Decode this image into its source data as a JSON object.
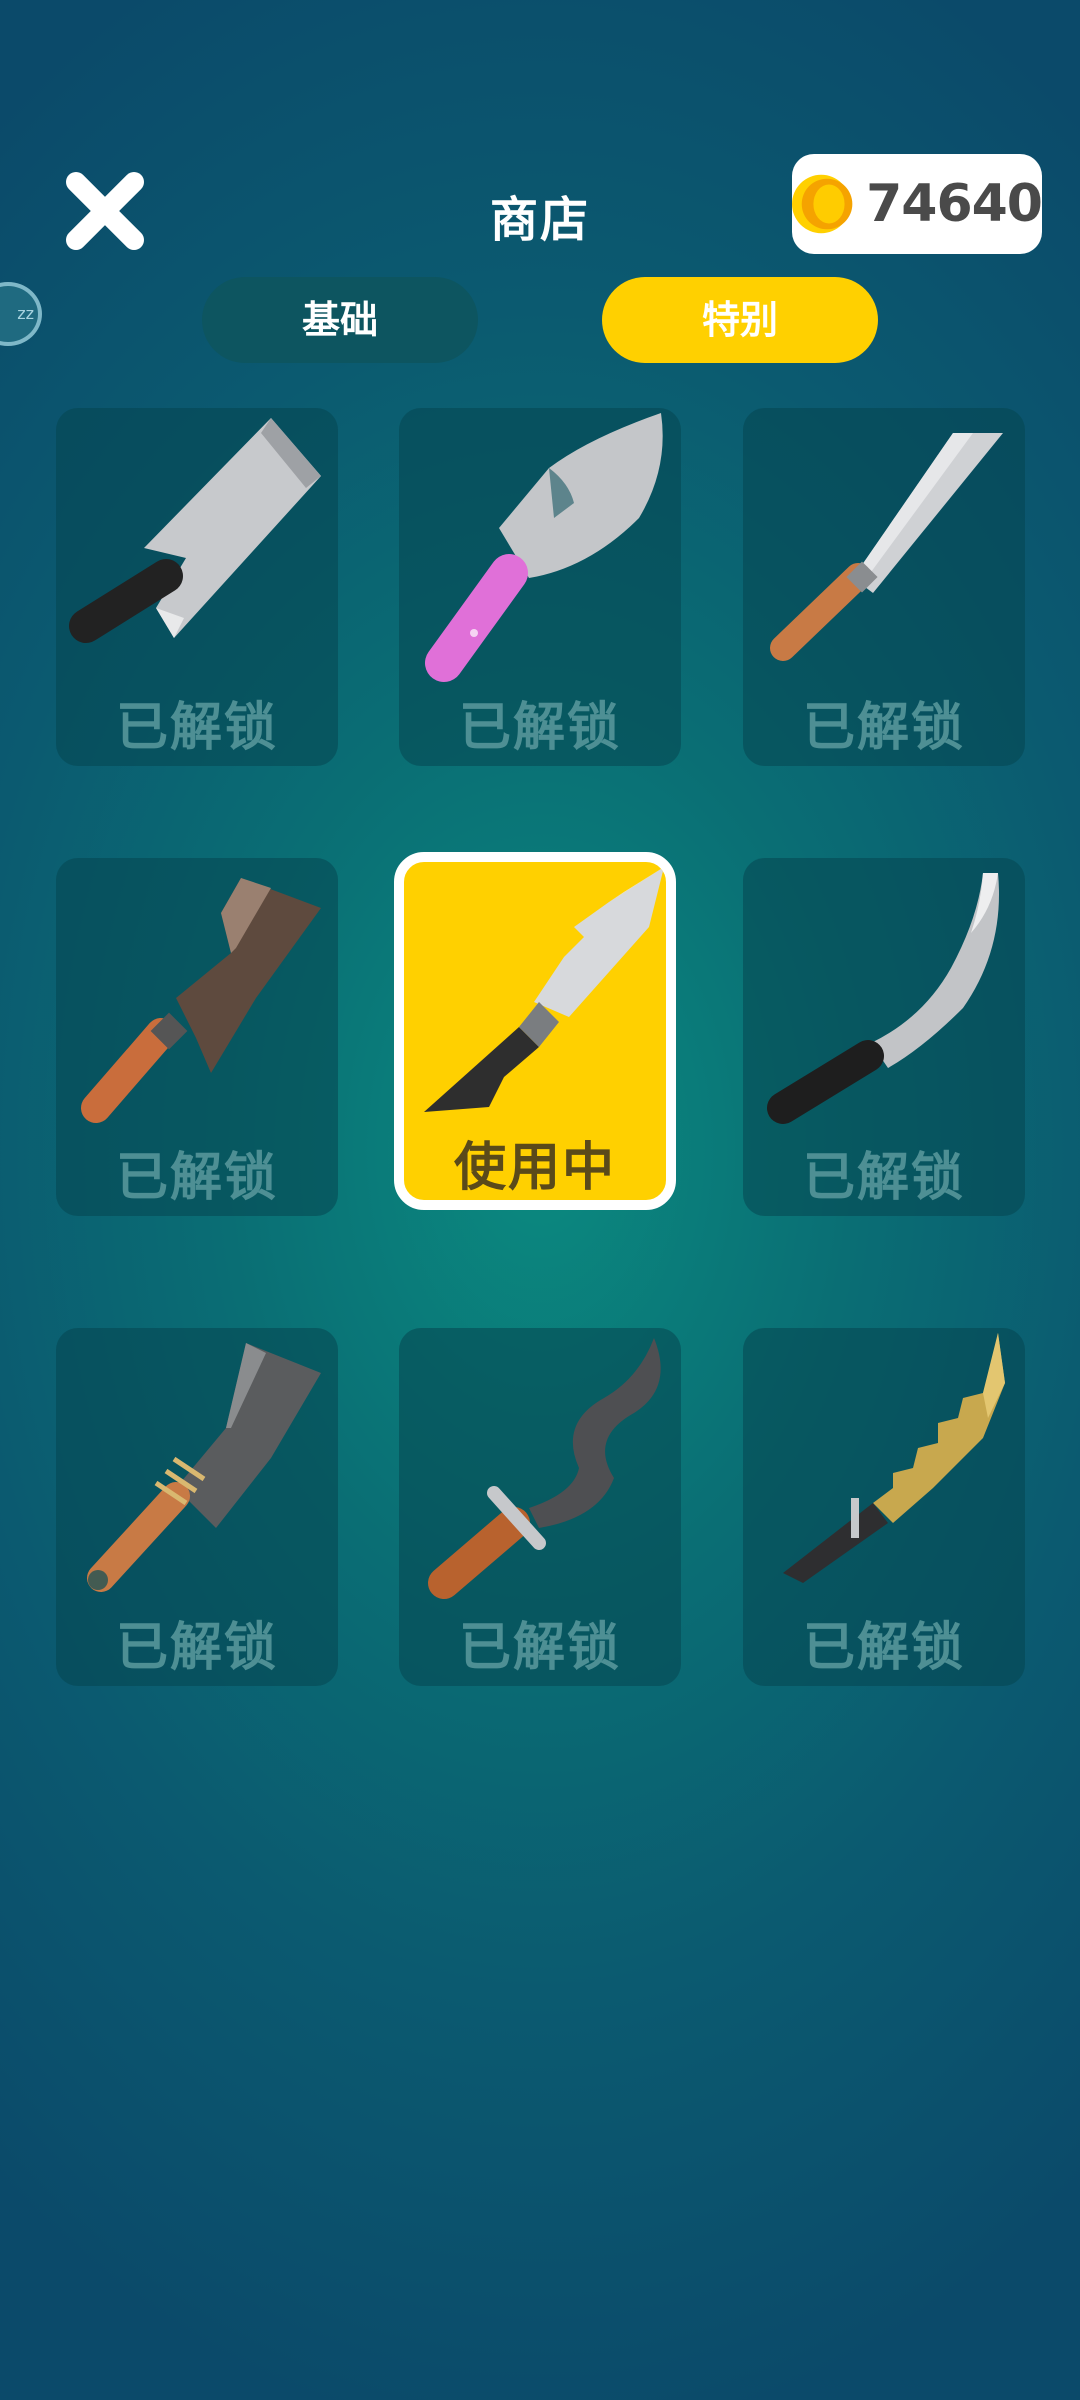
{
  "header": {
    "title": "商店",
    "coins": "74640"
  },
  "tabs": [
    {
      "label": "基础",
      "active": false
    },
    {
      "label": "特别",
      "active": true
    }
  ],
  "colors": {
    "accent": "#ffd000",
    "card_bg": "#0a4f59",
    "background": "#0b6a72"
  },
  "knives": [
    {
      "name": "cleaver-black-handle",
      "status": "已解锁"
    },
    {
      "name": "pink-handle-knife",
      "status": "已解锁"
    },
    {
      "name": "chef-knife-wood",
      "status": "已解锁"
    },
    {
      "name": "dark-chopper",
      "status": "已解锁"
    },
    {
      "name": "silver-hunting-knife",
      "status": "使用中"
    },
    {
      "name": "curved-machete",
      "status": "已解锁"
    },
    {
      "name": "rope-handle-cleaver",
      "status": "已解锁"
    },
    {
      "name": "wavy-blade-knife",
      "status": "已解锁"
    },
    {
      "name": "serrated-gold-blade",
      "status": "已解锁"
    }
  ]
}
